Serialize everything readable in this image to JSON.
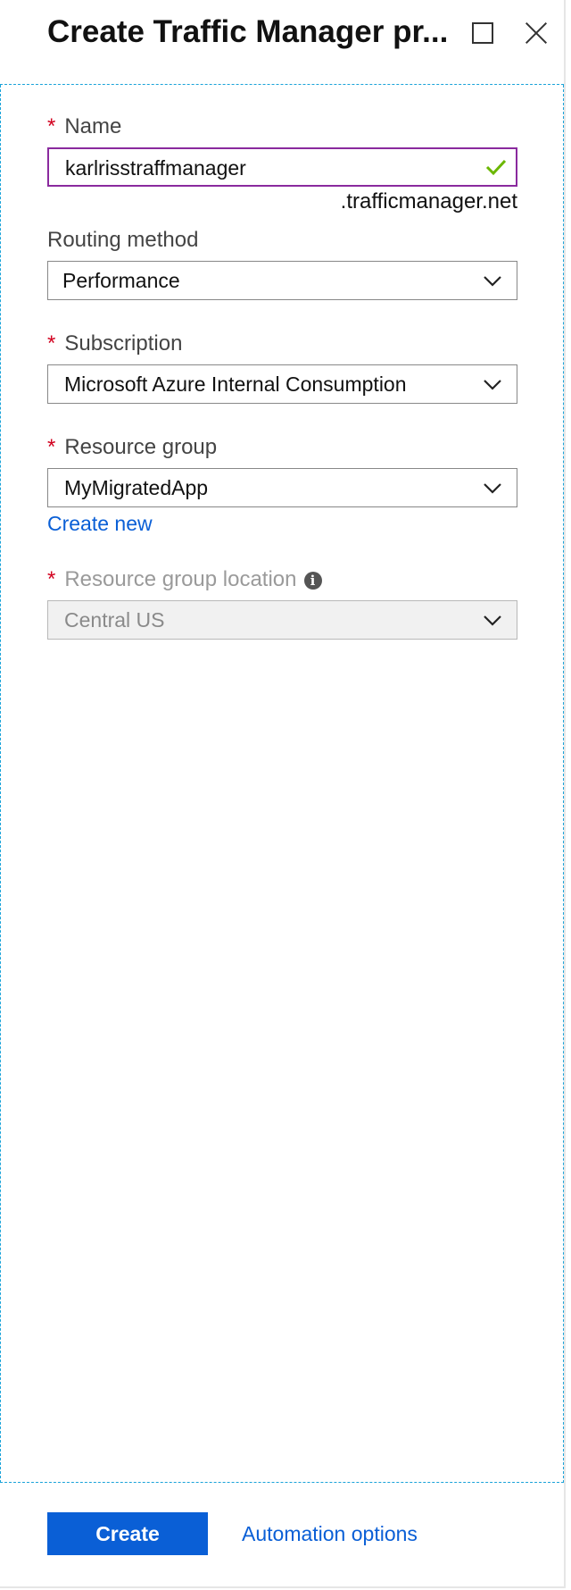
{
  "header": {
    "title": "Create Traffic Manager pr..."
  },
  "form": {
    "name": {
      "label": "Name",
      "value": "karlrisstraffmanager",
      "suffix": ".trafficmanager.net"
    },
    "routing_method": {
      "label": "Routing method",
      "value": "Performance"
    },
    "subscription": {
      "label": "Subscription",
      "value": "Microsoft Azure Internal Consumption"
    },
    "resource_group": {
      "label": "Resource group",
      "value": "MyMigratedApp",
      "create_new": "Create new"
    },
    "resource_group_location": {
      "label": "Resource group location",
      "value": "Central US"
    },
    "required_marker": "*"
  },
  "footer": {
    "create_label": "Create",
    "automation_label": "Automation options"
  },
  "icons": {
    "maximize": "maximize-icon",
    "close": "close-icon",
    "check": "checkmark-icon",
    "chevron": "chevron-down-icon",
    "info": "info-icon"
  },
  "colors": {
    "accent_blue": "#0a5fd6",
    "required_red": "#d2001f",
    "focus_purple": "#8a2a9e",
    "valid_green": "#6bb700",
    "dashed_border": "#1aa3d9"
  }
}
